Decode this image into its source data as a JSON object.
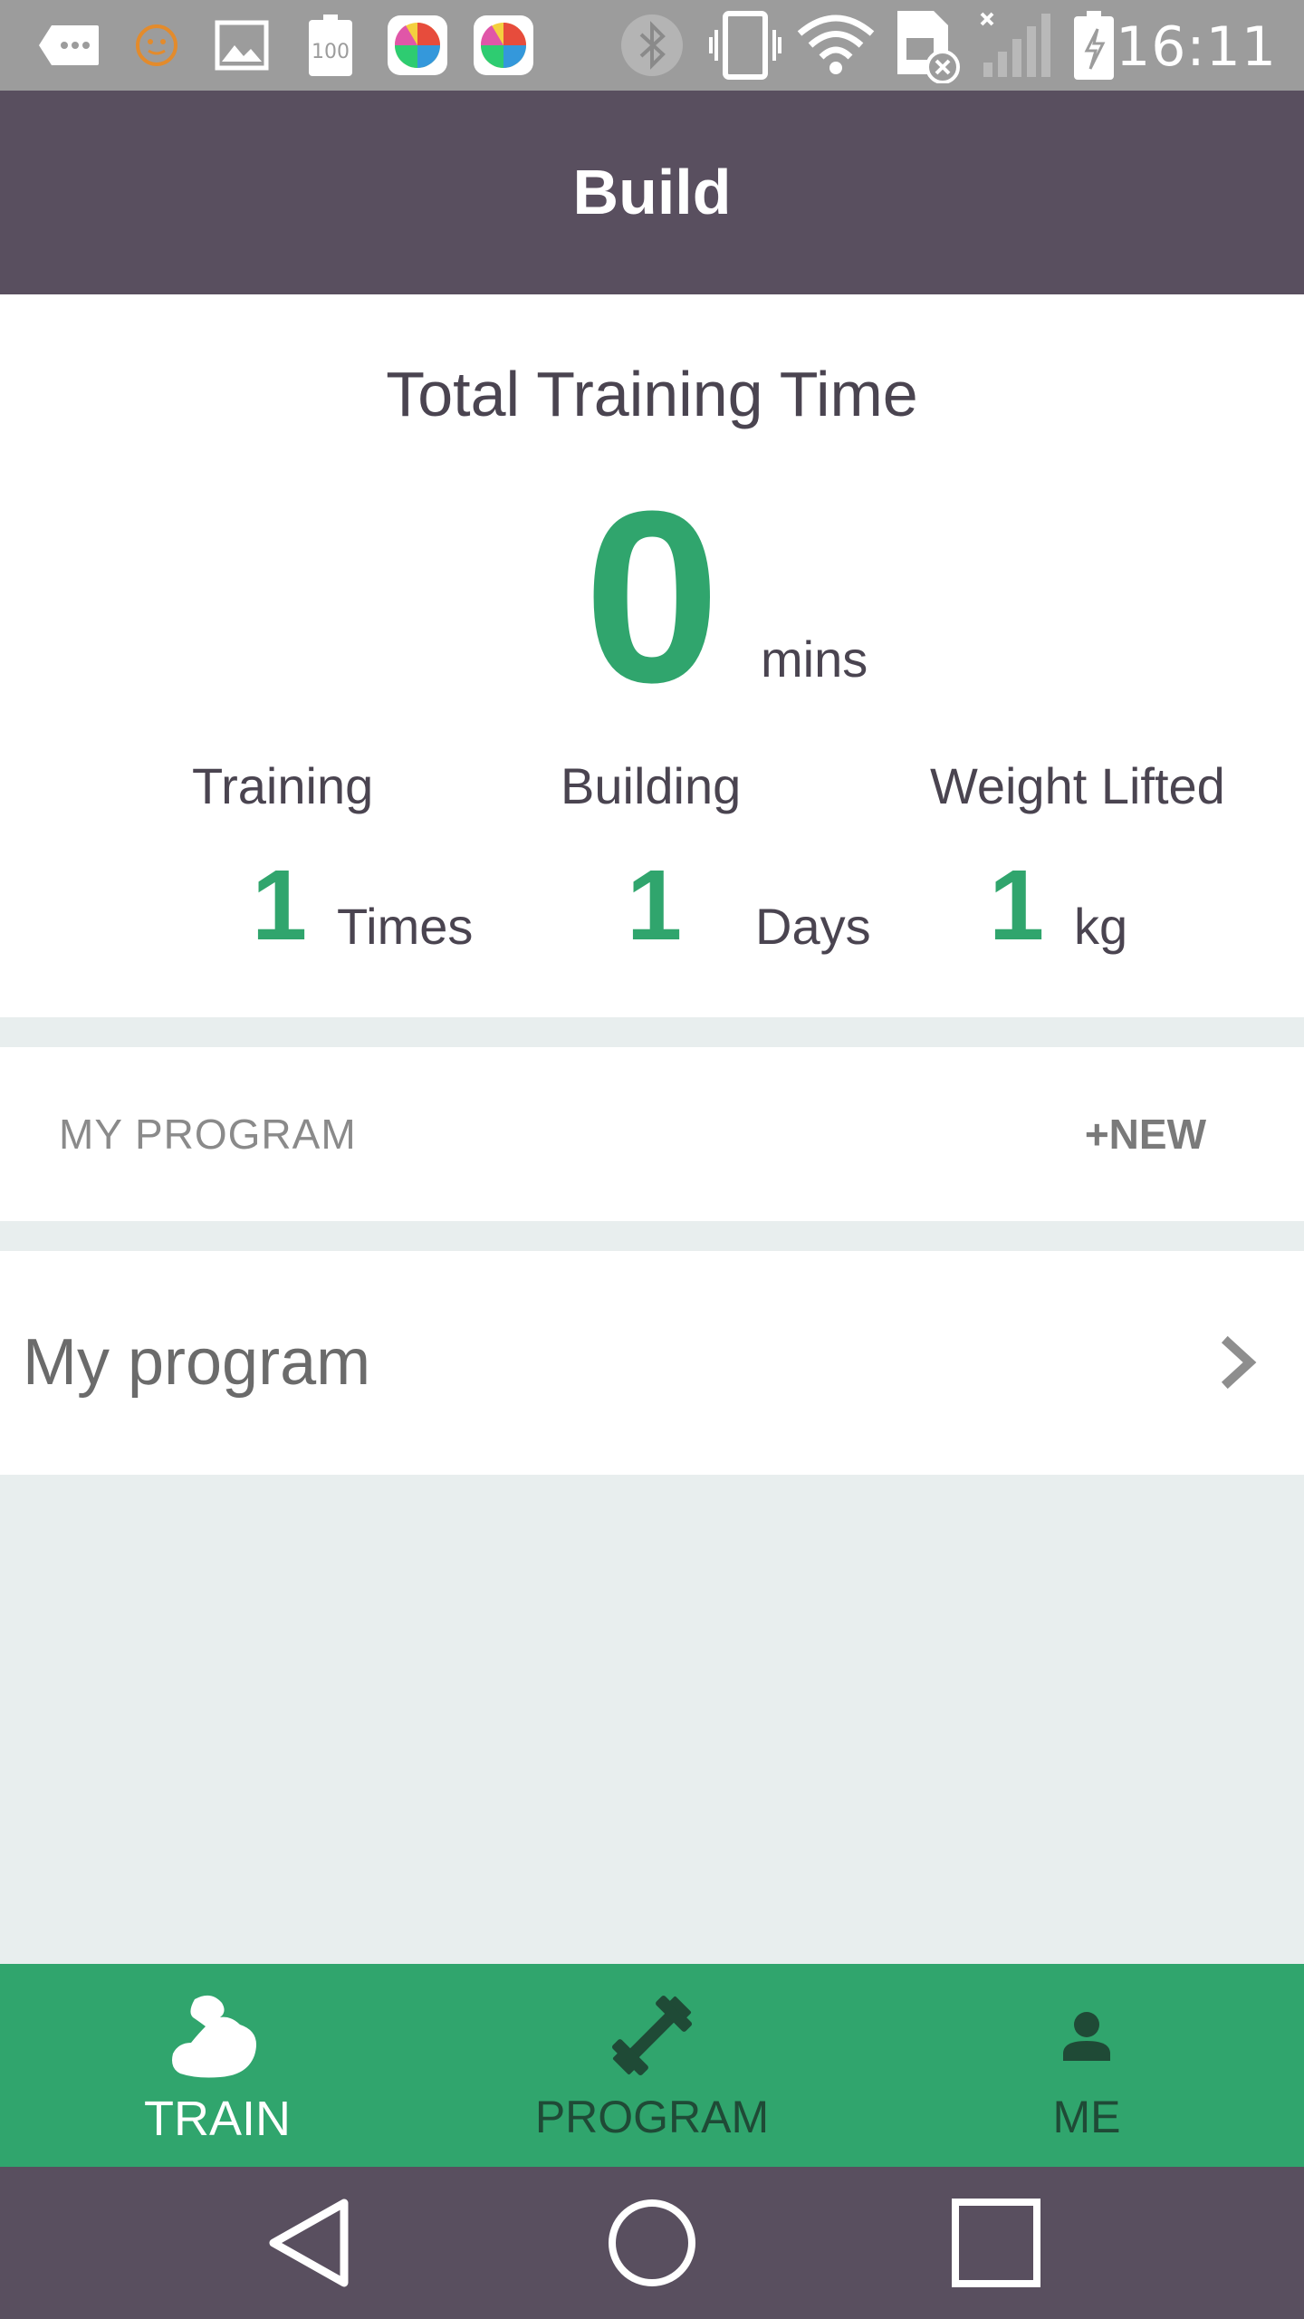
{
  "status_bar": {
    "time": "16:11",
    "battery_notification_text": "100",
    "icons": [
      "message-icon",
      "face-icon",
      "image-icon",
      "battery-full-icon",
      "app-icon",
      "app-icon",
      "bluetooth-icon",
      "vibrate-icon",
      "wifi-icon",
      "sim-icon",
      "signal-icon",
      "battery-charging-icon"
    ]
  },
  "app_bar": {
    "title": "Build"
  },
  "stats": {
    "total_title": "Total Training Time",
    "total_value": "0",
    "total_unit": "mins",
    "items": [
      {
        "label": "Training",
        "value": "1",
        "unit": "Times"
      },
      {
        "label": "Building",
        "value": "1",
        "unit": "Days"
      },
      {
        "label": "Weight Lifted",
        "value": "1",
        "unit": "kg"
      }
    ]
  },
  "program_section": {
    "title": "MY PROGRAM",
    "new_label": "+NEW"
  },
  "programs": [
    {
      "name": "My program"
    }
  ],
  "tabs": [
    {
      "label": "TRAIN",
      "icon": "muscle-arm-icon",
      "active": true
    },
    {
      "label": "PROGRAM",
      "icon": "dumbbell-icon",
      "active": false
    },
    {
      "label": "ME",
      "icon": "person-icon",
      "active": false
    }
  ],
  "nav_bar": {
    "icons": [
      "back-icon",
      "home-icon",
      "recents-icon"
    ]
  },
  "colors": {
    "accent_green": "#30a56d",
    "app_bar": "#594f5f",
    "background": "#e8eeee",
    "status_bar": "#9c9c9c"
  }
}
